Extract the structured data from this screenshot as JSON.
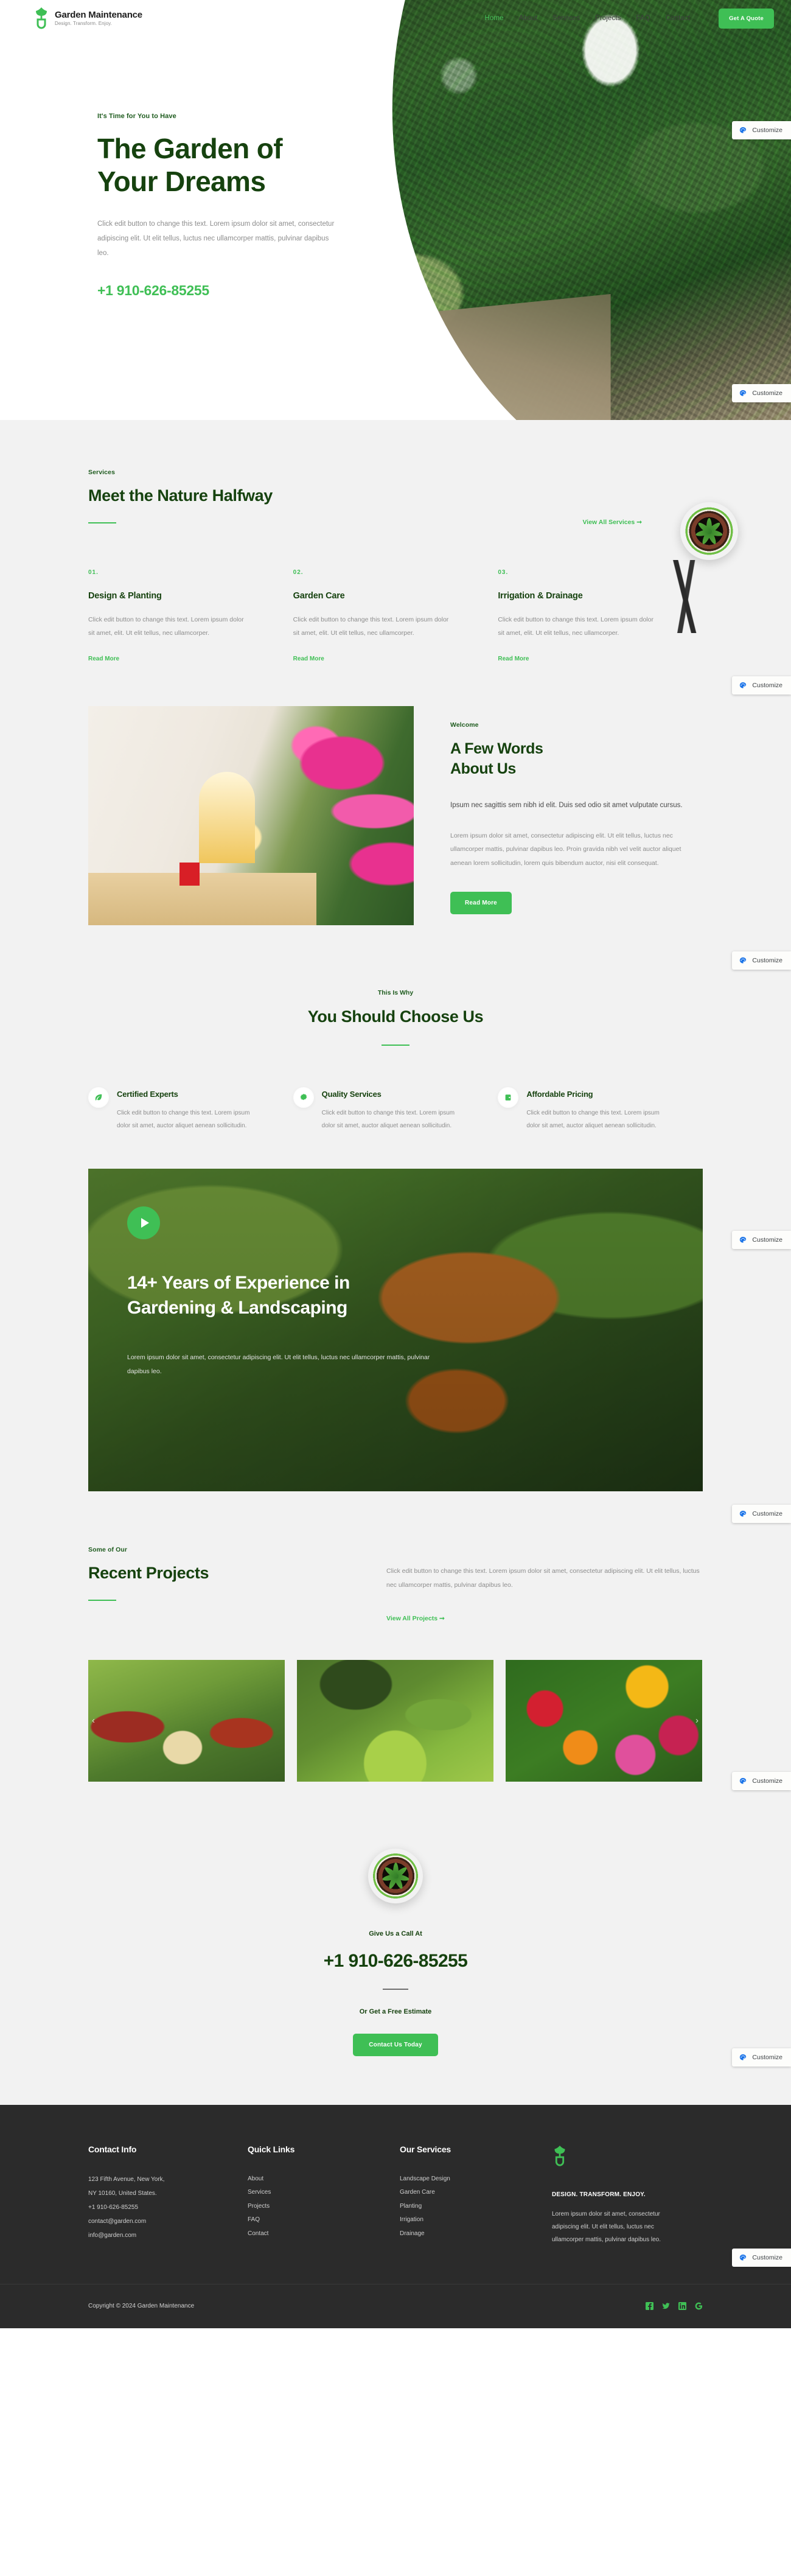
{
  "brand": {
    "name": "Garden Maintenance",
    "tagline": "Design. Transform. Enjoy.",
    "logo_icon": "shovel-leaf-logo-icon",
    "accent": "#3fbf55",
    "dark_green": "#16420f"
  },
  "nav": {
    "items": [
      {
        "label": "Home",
        "active": true
      },
      {
        "label": "About",
        "active": false
      },
      {
        "label": "Services",
        "active": false
      },
      {
        "label": "Projects",
        "active": false
      },
      {
        "label": "FAQ",
        "active": false
      },
      {
        "label": "Contact",
        "active": false
      }
    ],
    "cta_label": "Get A Quote"
  },
  "hero": {
    "eyebrow": "It's Time for You to Have",
    "title_line1": "The Garden of",
    "title_line2": "Your Dreams",
    "paragraph": "Click edit button to change this text. Lorem ipsum dolor sit amet, consectetur adipiscing elit. Ut elit tellus, luctus nec ullamcorper mattis, pulvinar dapibus leo.",
    "phone": "+1 910-626-85255"
  },
  "customize": {
    "label": "Customize",
    "icon": "palette-icon"
  },
  "services": {
    "eyebrow": "Services",
    "title": "Meet the Nature Halfway",
    "view_all": "View All Services",
    "items": [
      {
        "num": "01.",
        "title": "Design & Planting",
        "text": "Click edit button to change this text. Lorem ipsum dolor sit amet, elit. Ut elit tellus, nec ullamcorper.",
        "link": "Read More"
      },
      {
        "num": "02.",
        "title": "Garden Care",
        "text": "Click edit button to change this text. Lorem ipsum dolor sit amet, elit. Ut elit tellus, nec ullamcorper.",
        "link": "Read More"
      },
      {
        "num": "03.",
        "title": "Irrigation & Drainage",
        "text": "Click edit button to change this text. Lorem ipsum dolor sit amet, elit. Ut elit tellus, nec ullamcorper.",
        "link": "Read More"
      }
    ]
  },
  "about": {
    "eyebrow": "Welcome",
    "title_line1": "A Few Words",
    "title_line2": "About Us",
    "lead": "Ipsum nec sagittis sem nibh id elit. Duis sed odio sit amet vulputate cursus.",
    "body": "Lorem ipsum dolor sit amet, consectetur adipiscing elit. Ut elit tellus, luctus nec ullamcorper mattis, pulvinar dapibus leo. Proin gravida nibh vel velit auctor aliquet aenean lorem sollicitudin, lorem quis bibendum auctor, nisi elit consequat.",
    "button": "Read More",
    "image_alt": "courtyard-with-pink-flowers"
  },
  "choose": {
    "eyebrow": "This Is Why",
    "title": "You Should Choose Us",
    "features": [
      {
        "icon": "leaf-icon",
        "title": "Certified Experts",
        "text": "Click edit button to change this text. Lorem ipsum dolor sit amet, auctor aliquet aenean sollicitudin."
      },
      {
        "icon": "badge-icon",
        "title": "Quality Services",
        "text": "Click edit button to change this text. Lorem ipsum dolor sit amet, auctor aliquet aenean sollicitudin."
      },
      {
        "icon": "wallet-icon",
        "title": "Affordable Pricing",
        "text": "Click edit button to change this text. Lorem ipsum dolor sit amet, auctor aliquet aenean sollicitudin."
      }
    ]
  },
  "video": {
    "play_icon": "play-icon",
    "title_line1": "14+ Years of Experience in",
    "title_line2": "Gardening & Landscaping",
    "paragraph": "Lorem ipsum dolor sit amet, consectetur adipiscing elit. Ut elit tellus, luctus nec ullamcorper mattis, pulvinar dapibus leo.",
    "image_alt": "watering-can-spray-over-plants"
  },
  "projects": {
    "eyebrow": "Some of Our",
    "title": "Recent Projects",
    "paragraph": "Click edit button to change this text. Lorem ipsum dolor sit amet, consectetur adipiscing elit. Ut elit tellus, luctus nec ullamcorper mattis, pulvinar dapibus leo.",
    "view_all": "View All Projects",
    "cards": [
      {
        "alt": "garden-stone-path-with-red-flowers"
      },
      {
        "alt": "landscaped-lawn-with-shrubs"
      },
      {
        "alt": "colorful-daisy-flower-bed"
      }
    ],
    "prev_icon": "chevron-left-icon",
    "next_icon": "chevron-right-icon"
  },
  "cta": {
    "pot_icon": "potted-plant-icon",
    "eyebrow": "Give Us a Call At",
    "phone": "+1 910-626-85255",
    "sub": "Or Get a Free Estimate",
    "button": "Contact Us Today"
  },
  "footer": {
    "contact": {
      "heading": "Contact Info",
      "lines": [
        "123 Fifth Avenue, New York,",
        "NY 10160, United States.",
        "+1 910-626-85255",
        "contact@garden.com",
        "info@garden.com"
      ]
    },
    "quick_links": {
      "heading": "Quick Links",
      "items": [
        "About",
        "Services",
        "Projects",
        "FAQ",
        "Contact"
      ]
    },
    "our_services": {
      "heading": "Our Services",
      "items": [
        "Landscape Design",
        "Garden Care",
        "Planting",
        "Irrigation",
        "Drainage"
      ]
    },
    "brand_block": {
      "logo_icon": "shovel-leaf-logo-icon",
      "slogan": "DESIGN. TRANSFORM. ENJOY.",
      "text": "Lorem ipsum dolor sit amet, consectetur adipiscing elit. Ut elit tellus, luctus nec ullamcorper mattis, pulvinar dapibus leo."
    },
    "copyright": "Copyright © 2024 Garden Maintenance",
    "socials": [
      {
        "name": "facebook-icon",
        "glyph": "f"
      },
      {
        "name": "twitter-icon",
        "glyph": "t"
      },
      {
        "name": "linkedin-icon",
        "glyph": "in"
      },
      {
        "name": "google-icon",
        "glyph": "G"
      }
    ]
  }
}
